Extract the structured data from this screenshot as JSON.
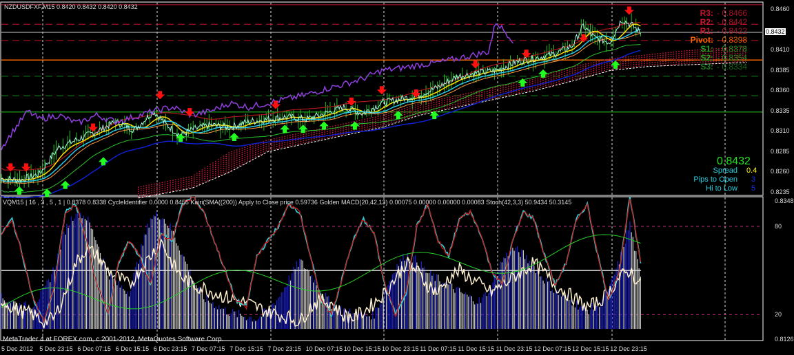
{
  "main_header": "NZDUSDFXF,M15  0.8420 0.8432 0.8420 0.8432",
  "sub_header": "VQM15 | 16 , 3 , 5 , 1 | 0.8378 0.8338  CycleIdentifier 0.0000 0.8455  Kairi(SMA((200)) Apply to Close price 0.59736  Golden MACD(20,42,13) 0.00075 0.00000 0.00000 0.00083  Stoch(42,3,3) 50.9434 50.3145",
  "copyright": "MetaTrader 4 at FOREX.com, c 2001-2012, MetaQuotes Software Corp.",
  "pivots": [
    {
      "label": "R3:",
      "value": "- 0.8466",
      "color": "#c0142a",
      "price": 0.8466
    },
    {
      "label": "R2:",
      "value": "- 0.8442",
      "color": "#d01a30",
      "price": 0.8442
    },
    {
      "label": "R1:",
      "value": "- 0.8422",
      "color": "#c0142a",
      "price": 0.8422
    },
    {
      "label": "Pivot:",
      "value": "- 0.8398",
      "color": "#ff6a00",
      "price": 0.8398
    },
    {
      "label": "S1:",
      "value": "- 0.8378",
      "color": "#1fa51f",
      "price": 0.8378
    },
    {
      "label": "S2:",
      "value": "- 0.8354",
      "color": "#1fa51f",
      "price": 0.8354
    },
    {
      "label": "S3:",
      "value": "- 0.8334",
      "color": "#1a7a1a",
      "price": 0.8334
    }
  ],
  "info": {
    "price": "0.8432",
    "spread_label": "Spread",
    "spread": "0.4",
    "pips_label": "Pips to Open",
    "pips": "3",
    "hilo_label": "Hi to Low",
    "hilo": "5"
  },
  "price_axis": [
    "0.8460",
    "0.8410",
    "0.8385",
    "0.8360",
    "0.8335",
    "0.8310",
    "0.8285",
    "0.8260",
    "0.8235"
  ],
  "current_price_tag": "0.8432",
  "sub_axis": {
    "top": "0.8348",
    "upper": "80",
    "lower": "20",
    "bottom": "0.8126"
  },
  "time_axis": [
    "5 Dec 2012",
    "5 Dec 23:15",
    "6 Dec 07:15",
    "6 Dec 15:15",
    "6 Dec 23:15",
    "7 Dec 07:15",
    "7 Dec 15:15",
    "7 Dec 23:15",
    "10 Dec 07:15",
    "10 Dec 15:15",
    "10 Dec 23:15",
    "11 Dec 07:15",
    "11 Dec 15:15",
    "11 Dec 23:15",
    "12 Dec 07:15",
    "12 Dec 15:15",
    "12 Dec 23:15"
  ],
  "chart_data": [
    {
      "type": "line",
      "title": "NZDUSDFXF,M15",
      "ylim": [
        0.8225,
        0.847
      ],
      "x_unit": "time-axis tick index (8h)",
      "close": [
        [
          0,
          0.8252
        ],
        [
          0.5,
          0.825
        ],
        [
          1,
          0.8258
        ],
        [
          1.5,
          0.829
        ],
        [
          2,
          0.83
        ],
        [
          2.5,
          0.831
        ],
        [
          3,
          0.8322
        ],
        [
          3.5,
          0.8312
        ],
        [
          4,
          0.8335
        ],
        [
          4.3,
          0.832
        ],
        [
          4.7,
          0.8305
        ],
        [
          5,
          0.8312
        ],
        [
          5.5,
          0.8318
        ],
        [
          6,
          0.8315
        ],
        [
          6.5,
          0.8322
        ],
        [
          7,
          0.8325
        ],
        [
          7.5,
          0.8328
        ],
        [
          8,
          0.8325
        ],
        [
          8.5,
          0.8332
        ],
        [
          9,
          0.834
        ],
        [
          9.5,
          0.8332
        ],
        [
          10,
          0.8345
        ],
        [
          10.5,
          0.835
        ],
        [
          11,
          0.8355
        ],
        [
          11.5,
          0.8365
        ],
        [
          12,
          0.8378
        ],
        [
          12.5,
          0.8382
        ],
        [
          13,
          0.8385
        ],
        [
          13.5,
          0.8395
        ],
        [
          14,
          0.84
        ],
        [
          14.5,
          0.8405
        ],
        [
          15,
          0.8415
        ],
        [
          15.3,
          0.844
        ],
        [
          15.6,
          0.8425
        ],
        [
          16,
          0.842
        ],
        [
          16.3,
          0.8448
        ],
        [
          16.6,
          0.844
        ],
        [
          16.8,
          0.8432
        ]
      ],
      "kairi": [
        [
          0,
          0.829
        ],
        [
          0.3,
          0.831
        ],
        [
          0.7,
          0.8335
        ],
        [
          1,
          0.8325
        ],
        [
          1.5,
          0.833
        ],
        [
          2,
          0.832
        ],
        [
          2.5,
          0.833
        ],
        [
          3,
          0.8322
        ],
        [
          3.5,
          0.8328
        ],
        [
          4,
          0.8335
        ],
        [
          4.5,
          0.834
        ],
        [
          5,
          0.833
        ],
        [
          5.5,
          0.8335
        ],
        [
          6,
          0.8345
        ],
        [
          6.5,
          0.834
        ],
        [
          7,
          0.8345
        ],
        [
          7.5,
          0.835
        ],
        [
          8,
          0.8355
        ],
        [
          8.5,
          0.8362
        ],
        [
          9,
          0.8368
        ],
        [
          9.5,
          0.8375
        ],
        [
          10,
          0.8385
        ],
        [
          10.5,
          0.8388
        ],
        [
          11,
          0.8392
        ],
        [
          11.5,
          0.8395
        ],
        [
          12,
          0.84
        ],
        [
          12.5,
          0.8405
        ],
        [
          12.8,
          0.8408
        ],
        [
          13,
          0.8445
        ],
        [
          13.3,
          0.843
        ],
        [
          13.5,
          0.842
        ]
      ],
      "cloud": [
        [
          3.6,
          0.8228,
          0.8242
        ],
        [
          5,
          0.824,
          0.8255
        ],
        [
          6,
          0.826,
          0.8285
        ],
        [
          7,
          0.8285,
          0.83
        ],
        [
          8,
          0.8295,
          0.831
        ],
        [
          9,
          0.8305,
          0.832
        ],
        [
          10,
          0.8315,
          0.833
        ],
        [
          11,
          0.833,
          0.8345
        ],
        [
          12,
          0.834,
          0.8355
        ],
        [
          13,
          0.835,
          0.8365
        ],
        [
          14,
          0.836,
          0.8375
        ],
        [
          15,
          0.8372,
          0.839
        ],
        [
          16,
          0.8385,
          0.84
        ],
        [
          17,
          0.839,
          0.8405
        ],
        [
          18,
          0.8392,
          0.841
        ],
        [
          19.6,
          0.8395,
          0.8415
        ]
      ],
      "sell_arrows": [
        [
          0.24,
          0.8264
        ],
        [
          0.65,
          0.8264
        ],
        [
          2.41,
          0.8313
        ],
        [
          4.17,
          0.8353
        ],
        [
          4.95,
          0.8332
        ],
        [
          7.21,
          0.8341
        ],
        [
          9.2,
          0.8345
        ],
        [
          10,
          0.8359
        ],
        [
          10.9,
          0.8355
        ],
        [
          12.46,
          0.8391
        ],
        [
          13.8,
          0.8404
        ],
        [
          15.3,
          0.8423
        ],
        [
          16.5,
          0.8457
        ]
      ],
      "buy_arrows": [
        [
          0.47,
          0.8239
        ],
        [
          1.2,
          0.8236
        ],
        [
          1.68,
          0.8246
        ],
        [
          2.68,
          0.8275
        ],
        [
          4.71,
          0.8304
        ],
        [
          6.12,
          0.8305
        ],
        [
          7.45,
          0.8315
        ],
        [
          7.93,
          0.8315
        ],
        [
          8.48,
          0.8319
        ],
        [
          9.29,
          0.8319
        ],
        [
          10.43,
          0.8332
        ],
        [
          11.38,
          0.8332
        ],
        [
          13.7,
          0.8372
        ],
        [
          14.24,
          0.8383
        ],
        [
          16.14,
          0.8394
        ]
      ]
    },
    {
      "type": "line",
      "title": "VQM15 oscillators",
      "ylim": [
        0,
        100
      ],
      "x_range": [
        0,
        16.8
      ],
      "stoch": [
        75,
        85,
        60,
        30,
        15,
        40,
        90,
        95,
        70,
        40,
        20,
        55,
        70,
        60,
        40,
        75,
        70,
        95,
        100,
        90,
        70,
        50,
        30,
        25,
        60,
        70,
        80,
        95,
        90,
        60,
        30,
        20,
        45,
        70,
        85,
        75,
        40,
        20,
        35,
        80,
        95,
        70,
        60,
        85,
        90,
        75,
        50,
        40,
        70,
        90,
        85,
        60,
        40,
        55,
        85,
        95,
        60,
        30,
        50,
        100,
        55
      ],
      "kairi_line": [
        30,
        25,
        22,
        20,
        15,
        18,
        35,
        55,
        65,
        60,
        50,
        45,
        40,
        50,
        60,
        70,
        55,
        45,
        40,
        38,
        35,
        32,
        30,
        28,
        25,
        22,
        20,
        18,
        15,
        25,
        30,
        28,
        20,
        18,
        22,
        28,
        35,
        45,
        55,
        50,
        40,
        35,
        45,
        50,
        45,
        40,
        35,
        40,
        45,
        50,
        55,
        48,
        40,
        35,
        30,
        25,
        28,
        35,
        45,
        50,
        40
      ],
      "histogram": [
        25,
        22,
        18,
        20,
        30,
        50,
        80,
        95,
        90,
        70,
        45,
        35,
        30,
        60,
        90,
        92,
        80,
        60,
        40,
        25,
        20,
        15,
        12,
        10,
        8,
        15,
        25,
        40,
        55,
        45,
        30,
        20,
        15,
        12,
        10,
        12,
        30,
        50,
        60,
        55,
        45,
        40,
        35,
        30,
        25,
        22,
        35,
        55,
        65,
        60,
        50,
        40,
        30,
        25,
        20,
        15,
        20,
        30,
        55,
        85,
        40
      ]
    }
  ]
}
